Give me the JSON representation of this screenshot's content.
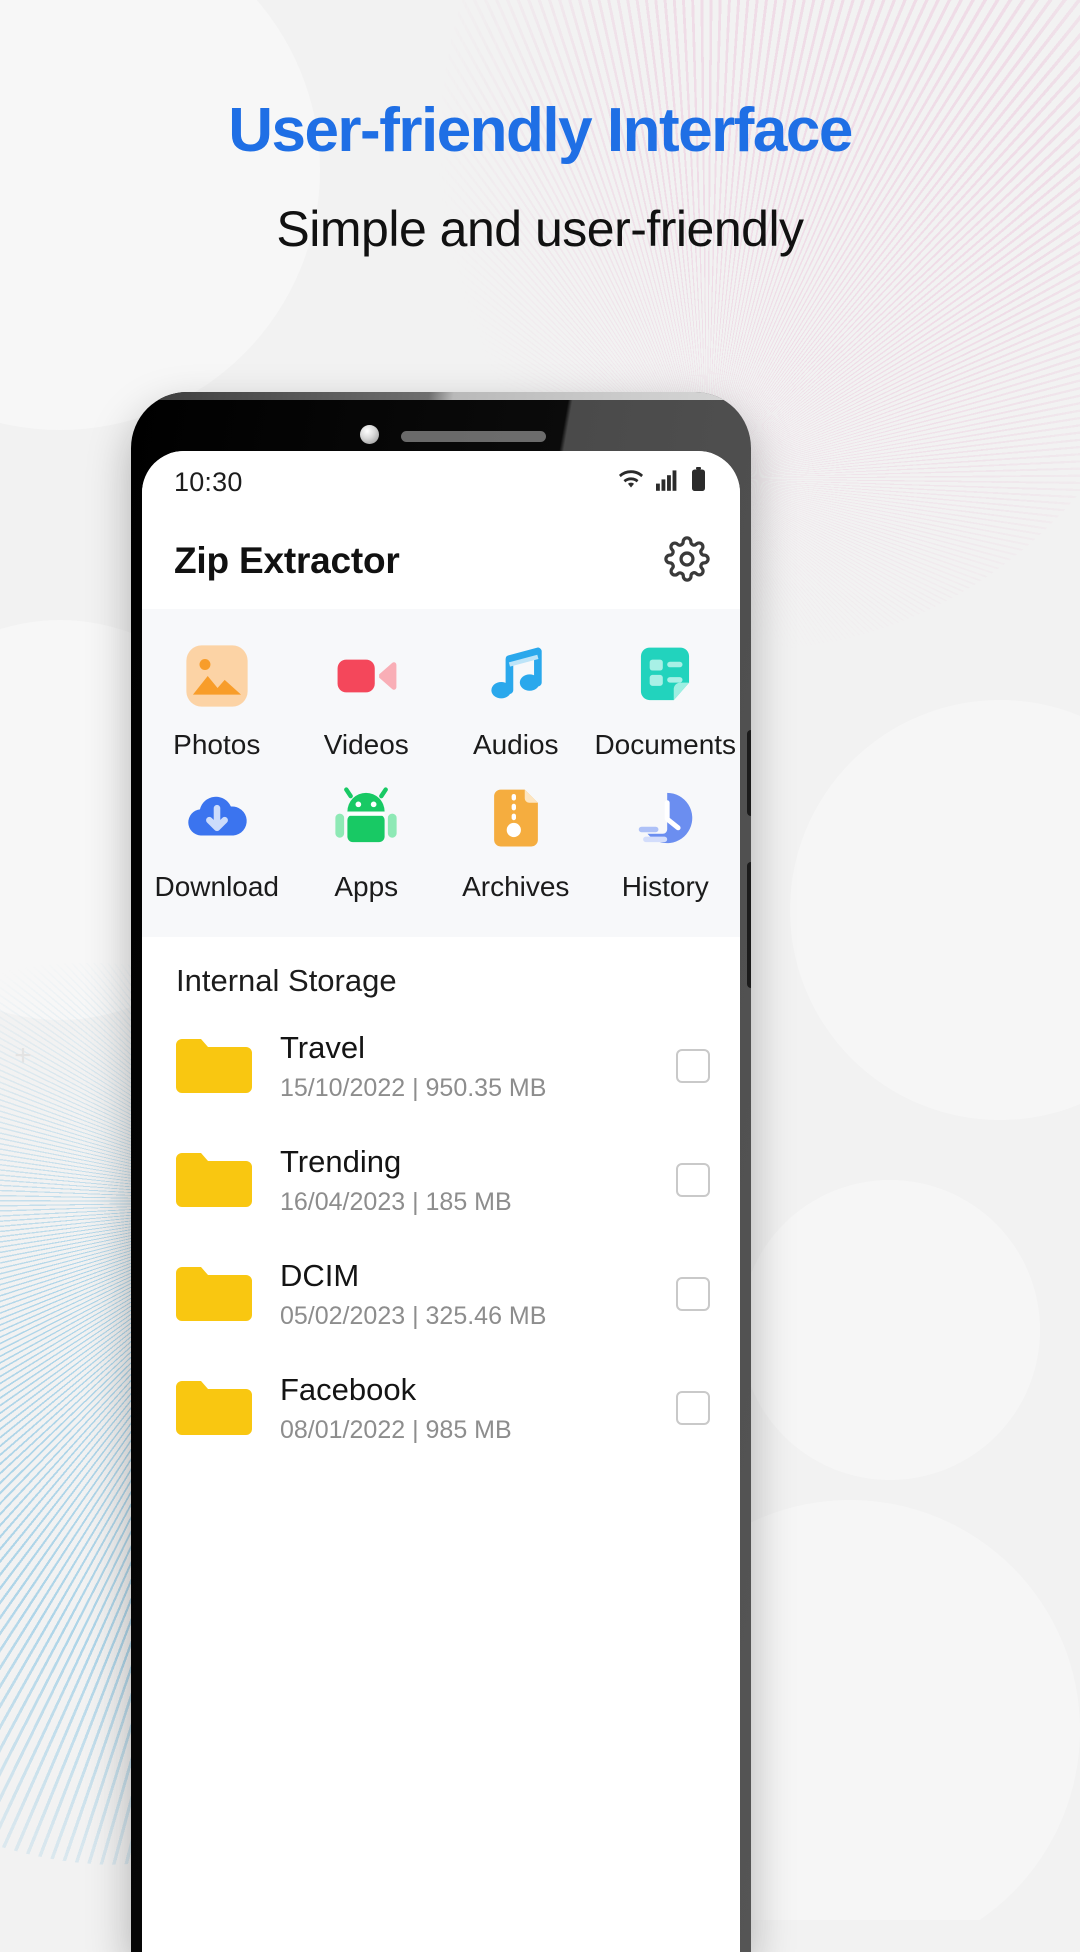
{
  "hero": {
    "headline": "User-friendly Interface",
    "subheadline": "Simple and user-friendly",
    "headline_color": "#1f6fe5",
    "subheadline_color": "#111111"
  },
  "phone": {
    "statusbar": {
      "time": "10:30",
      "icons": [
        "wifi-icon",
        "cellular-signal-icon",
        "battery-icon"
      ]
    },
    "appbar": {
      "title": "Zip Extractor",
      "settings_icon": "gear-icon"
    },
    "categories": [
      {
        "label": "Photos",
        "icon": "photos-icon",
        "color": "#f89d2a"
      },
      {
        "label": "Videos",
        "icon": "videos-icon",
        "color": "#f4475b"
      },
      {
        "label": "Audios",
        "icon": "audios-icon",
        "color": "#2aa8ec"
      },
      {
        "label": "Documents",
        "icon": "documents-icon",
        "color": "#22d3bd"
      },
      {
        "label": "Download",
        "icon": "download-icon",
        "color": "#3b74ef"
      },
      {
        "label": "Apps",
        "icon": "apps-icon",
        "color": "#18c964"
      },
      {
        "label": "Archives",
        "icon": "archives-icon",
        "color": "#f5ad3f"
      },
      {
        "label": "History",
        "icon": "history-icon",
        "color": "#6b8ef0"
      }
    ],
    "storage": {
      "section_title": "Internal Storage",
      "folder_color": "#f9c711",
      "items": [
        {
          "name": "Travel",
          "date": "15/10/2022",
          "size": "950.35 MB",
          "sub": "15/10/2022 | 950.35 MB",
          "checked": false
        },
        {
          "name": "Trending",
          "date": "16/04/2023",
          "size": "185 MB",
          "sub": "16/04/2023 | 185 MB",
          "checked": false
        },
        {
          "name": "DCIM",
          "date": "05/02/2023",
          "size": "325.46 MB",
          "sub": "05/02/2023 | 325.46 MB",
          "checked": false
        },
        {
          "name": "Facebook",
          "date": "08/01/2022",
          "size": "985 MB",
          "sub": "08/01/2022 | 985 MB",
          "checked": false
        }
      ]
    }
  }
}
